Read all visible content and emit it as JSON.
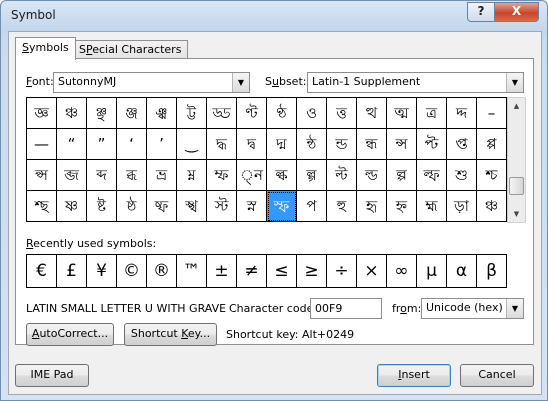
{
  "window": {
    "title": "Symbol"
  },
  "titlebar_buttons": {
    "help": "?",
    "close": "X"
  },
  "tabs": [
    {
      "label": "Symbols",
      "accel": "S",
      "rest": "ymbols"
    },
    {
      "label": "Special Characters",
      "accel": "P",
      "pre": "",
      "rest": "ecial Characters",
      "pre2": "S"
    }
  ],
  "font": {
    "label_accel": "F",
    "label_rest": "ont:",
    "value": "SutonnyMJ"
  },
  "subset": {
    "label_accel": "u",
    "label_pre": "S",
    "label_rest": "bset:",
    "value": "Latin-1 Supplement"
  },
  "symbols": [
    [
      "জ্ঞ",
      "ঞ্চ",
      "ঞ্ছ",
      "ঞ্জ",
      "ঞ্ঝ",
      "ট্ট",
      "ড্ড",
      "ণ্ট",
      "ণ্ঠ",
      "ও",
      "ত্ত",
      "ত্থ",
      "ত্ম",
      "ত্র",
      "দ্দ",
      "–"
    ],
    [
      "—",
      "“",
      "”",
      "‘",
      "’",
      "‿",
      "দ্ধ",
      "দ্ব",
      "দ্ম",
      "ন্ঠ",
      "ন্ড",
      "ন্ধ",
      "ন্স",
      "প্ট",
      "প্ত",
      "প্প"
    ],
    [
      "প্স",
      "ব্জ",
      "ব্দ",
      "ব্ধ",
      "ভ্র",
      "ম্ন",
      "ম্ফ",
      "্ন",
      "ল্ক",
      "ল্গ",
      "ল্ট",
      "ল্ড",
      "ল্প",
      "ল্ফ",
      "শু",
      "শ্চ"
    ],
    [
      "শ্ছ",
      "ষ্ণ",
      "ষ্ট",
      "ষ্ঠ",
      "ষ্ফ",
      "স্খ",
      "স্ট",
      "স্ন",
      "স্ফ",
      "প",
      "হু",
      "হৃ",
      "হ্ন",
      "হ্ম",
      "ড়া",
      "ঞ্চ"
    ]
  ],
  "selected_symbol": "স্ফ",
  "recent": {
    "label_accel": "R",
    "label_rest": "ecently used symbols:",
    "symbols": [
      "€",
      "£",
      "¥",
      "©",
      "®",
      "™",
      "±",
      "≠",
      "≤",
      "≥",
      "÷",
      "×",
      "∞",
      "µ",
      "α",
      "β"
    ]
  },
  "char_name": "LATIN SMALL LETTER U WITH GRAVE",
  "char_code": {
    "label_pre": "Character code:",
    "value": "00F9"
  },
  "from": {
    "label_pre": "fr",
    "label_accel": "o",
    "label_rest": "m:",
    "value": "Unicode (hex)"
  },
  "buttons": {
    "autocorrect": {
      "accel": "A",
      "rest": "utoCorrect..."
    },
    "shortcut": {
      "pre": "Shortcut ",
      "accel": "K",
      "rest": "ey..."
    },
    "ime_pad": "IME Pad",
    "insert": {
      "accel": "I",
      "rest": "nsert"
    },
    "cancel": "Cancel"
  },
  "shortcut_key": "Shortcut key: Alt+0249"
}
